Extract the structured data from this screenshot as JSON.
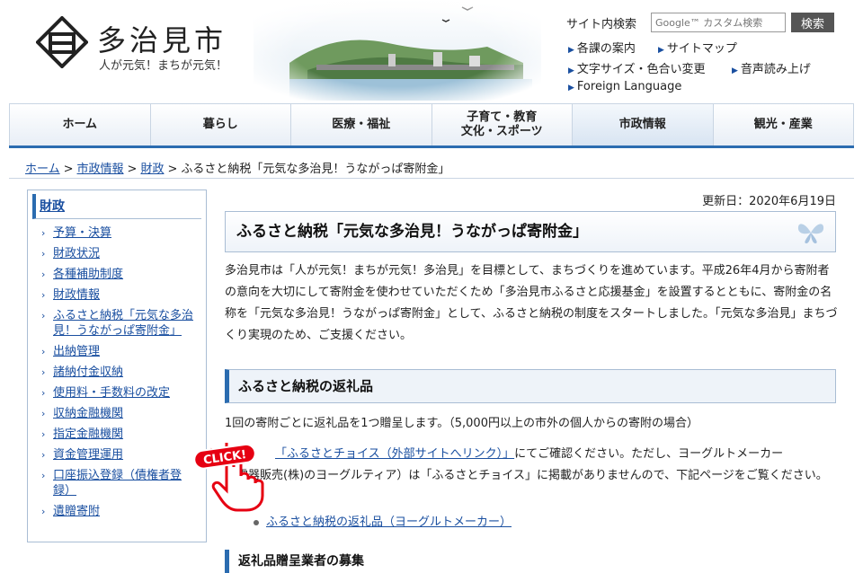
{
  "header": {
    "site_title": "多治見市",
    "slogan": "人が元気！まちが元気！",
    "search_label": "サイト内検索",
    "search_placeholder": "Google™ カスタム検索",
    "search_button": "検索",
    "util_links": [
      "各課の案内",
      "サイトマップ",
      "文字サイズ・色合い変更",
      "音声読み上げ",
      "Foreign Language"
    ]
  },
  "nav": {
    "items": [
      "ホーム",
      "暮らし",
      "医療・福祉",
      "子育て・教育\n文化・スポーツ",
      "市政情報",
      "観光・産業"
    ],
    "active": "市政情報"
  },
  "breadcrumb": {
    "links": [
      "ホーム",
      "市政情報",
      "財政"
    ],
    "current": "ふるさと納税「元気な多治見！うながっぱ寄附金」"
  },
  "sidebar": {
    "heading": "財政",
    "items": [
      "予算・決算",
      "財政状況",
      "各種補助制度",
      "財政情報",
      "ふるさと納税「元気な多治見！うながっぱ寄附金」",
      "出納管理",
      "諸納付金収納",
      "使用料・手数料の改定",
      "収納金融機関",
      "指定金融機関",
      "資金管理運用",
      "口座振込登録（債権者登録）",
      "遺贈寄附"
    ]
  },
  "main": {
    "updated": "更新日：2020年6月19日",
    "title": "ふるさと納税「元気な多治見！うながっぱ寄附金」",
    "intro": "多治見市は「人が元気！まちが元気！多治見」を目標として、まちづくりを進めています。平成26年4月から寄附者の意向を大切にして寄附金を使わせていただくため「多治見市ふるさと応援基金」を設置するとともに、寄附金の名称を「元気な多治見！うながっぱ寄附金」として、ふるさと納税の制度をスタートしました。「元気な多治見」まちづくり実現のため、ご支援ください。",
    "section_title": "ふるさと納税の返礼品",
    "section_line1": "1回の寄附ごとに返礼品を1つ贈呈します。（5,000円以上の市外の個人からの寄附の場合）",
    "section_link": "「ふるさとチョイス（外部サイトへリンク）」",
    "section_after_link": "にてご確認ください。ただし、ヨーグルトメーカー",
    "section_line3": "（電器販売(株)のヨーグルティア）は「ふるさとチョイス」に掲載がありませんので、下記ページをご覧ください。",
    "bullet_link": "ふるさと納税の返礼品（ヨーグルトメーカー）",
    "subsection_title": "返礼品贈呈業者の募集"
  },
  "overlay": {
    "click_text": "CLICK!"
  }
}
